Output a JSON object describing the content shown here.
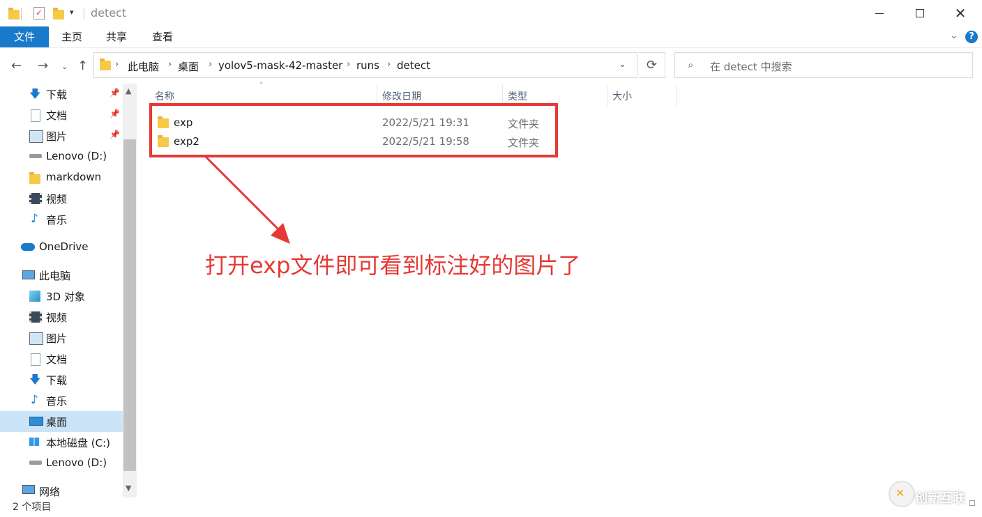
{
  "window": {
    "title": "detect"
  },
  "ribbon": {
    "tabs": [
      "文件",
      "主页",
      "共享",
      "查看"
    ]
  },
  "address": {
    "crumbs": [
      "此电脑",
      "桌面",
      "yolov5-mask-42-master",
      "runs",
      "detect"
    ]
  },
  "search": {
    "placeholder": "在 detect 中搜索"
  },
  "sidebar": {
    "items": [
      {
        "label": "下载",
        "icon": "download-arrow-icon",
        "pinned": true
      },
      {
        "label": "文档",
        "icon": "document-icon",
        "pinned": true
      },
      {
        "label": "图片",
        "icon": "picture-icon",
        "pinned": true
      },
      {
        "label": "Lenovo (D:)",
        "icon": "drive-icon"
      },
      {
        "label": "markdown",
        "icon": "folder-icon"
      },
      {
        "label": "视频",
        "icon": "film-icon"
      },
      {
        "label": "音乐",
        "icon": "music-note-icon"
      },
      {
        "label": "OneDrive",
        "icon": "cloud-icon"
      },
      {
        "label": "此电脑",
        "icon": "computer-icon"
      },
      {
        "label": "3D 对象",
        "icon": "cube-icon"
      },
      {
        "label": "视频",
        "icon": "film-icon"
      },
      {
        "label": "图片",
        "icon": "picture-icon"
      },
      {
        "label": "文档",
        "icon": "document-icon"
      },
      {
        "label": "下载",
        "icon": "download-arrow-icon"
      },
      {
        "label": "音乐",
        "icon": "music-note-icon"
      },
      {
        "label": "桌面",
        "icon": "desktop-icon",
        "selected": true
      },
      {
        "label": "本地磁盘 (C:)",
        "icon": "windows-drive-icon"
      },
      {
        "label": "Lenovo (D:)",
        "icon": "drive-icon"
      },
      {
        "label": "网络",
        "icon": "network-icon"
      }
    ]
  },
  "columns": {
    "name": "名称",
    "modified": "修改日期",
    "type": "类型",
    "size": "大小"
  },
  "files": [
    {
      "name": "exp",
      "modified": "2022/5/21 19:31",
      "type": "文件夹"
    },
    {
      "name": "exp2",
      "modified": "2022/5/21 19:58",
      "type": "文件夹"
    }
  ],
  "annotation": {
    "text": "打开exp文件即可看到标注好的图片了",
    "color": "#e53935"
  },
  "status": {
    "count": "2 个项目"
  },
  "watermark": {
    "text": "创新互联"
  },
  "colors": {
    "accent": "#1979ca",
    "selection": "#cce4f7"
  }
}
